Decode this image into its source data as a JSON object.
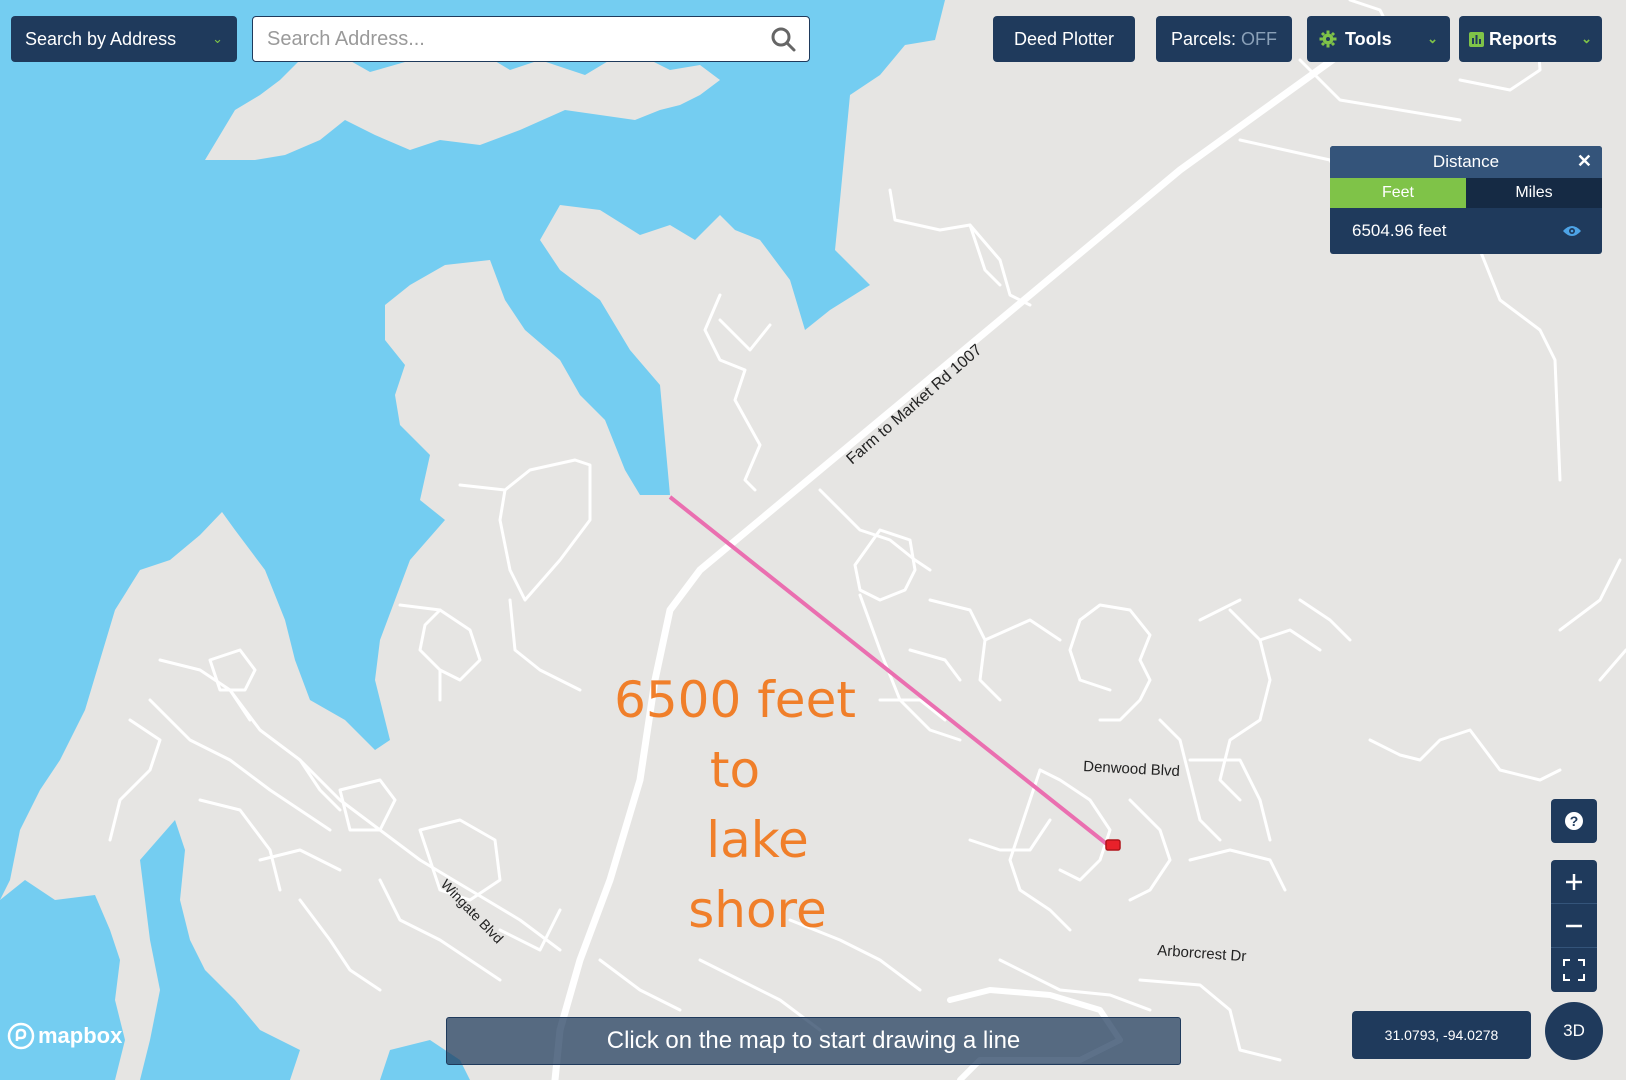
{
  "toolbar": {
    "search_mode": "Search by Address",
    "search_placeholder": "Search Address...",
    "deed_plotter": "Deed Plotter",
    "parcels_label": "Parcels:",
    "parcels_state": "OFF",
    "tools": "Tools",
    "reports": "Reports"
  },
  "distance_panel": {
    "title": "Distance",
    "tabs": [
      "Feet",
      "Miles"
    ],
    "active_tab": "Feet",
    "result": "6504.96 feet"
  },
  "map": {
    "road_labels": {
      "fm1007": "Farm to Market Rd 1007",
      "denwood": "Denwood Blvd",
      "wingate": "Wingate Blvd",
      "arborcrest": "Arborcrest Dr"
    },
    "annotation": [
      "6500 feet to",
      "lake shore"
    ],
    "coordinates": "31.0793, -94.0278",
    "draw_hint": "Click on the map to start drawing a line",
    "attribution": "mapbox"
  },
  "controls": {
    "view_3d": "3D"
  },
  "colors": {
    "water": "#74cdf1",
    "land": "#e6e5e3",
    "road": "#ffffff",
    "measure_line": "#ea6fb0",
    "panel": "#1f3a5c",
    "accent_green": "#7fc348",
    "annotation": "#f07f2a"
  },
  "icons": [
    "search-icon",
    "chevron-down-icon",
    "gear-icon",
    "bar-chart-icon",
    "close-icon",
    "eye-icon",
    "help-icon",
    "plus-icon",
    "minus-icon",
    "fullscreen-icon",
    "mapbox-logo-icon",
    "parcel-marker-icon"
  ]
}
